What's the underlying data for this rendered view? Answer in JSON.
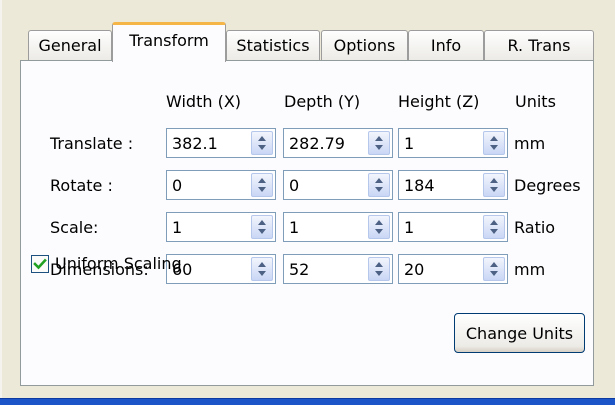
{
  "tabs": [
    "General",
    "Transform",
    "Statistics",
    "Options",
    "Info",
    "R. Trans"
  ],
  "active_tab": "Transform",
  "columns": {
    "width": "Width (X)",
    "depth": "Depth (Y)",
    "height": "Height (Z)",
    "units": "Units"
  },
  "rows": [
    {
      "label": "Translate :",
      "x": "382.1",
      "y": "282.79",
      "z": "1",
      "unit": "mm"
    },
    {
      "label": "Rotate :",
      "x": "0",
      "y": "0",
      "z": "184",
      "unit": "Degrees"
    },
    {
      "label": "Scale:",
      "x": "1",
      "y": "1",
      "z": "1",
      "unit": "Ratio"
    },
    {
      "label": "Dimensions:",
      "x": "60",
      "y": "52",
      "z": "20",
      "unit": "mm"
    }
  ],
  "uniform_scaling": {
    "label": "Uniform Scaling",
    "checked": true
  },
  "change_units_label": "Change Units",
  "colors": {
    "tab_highlight": "#f5b547",
    "window_frame": "#1c55c7",
    "field_border": "#7f9db9",
    "checkmark": "#21a121"
  },
  "icons": {
    "spinner": "up-down-arrows-icon",
    "check": "checkmark-icon"
  }
}
